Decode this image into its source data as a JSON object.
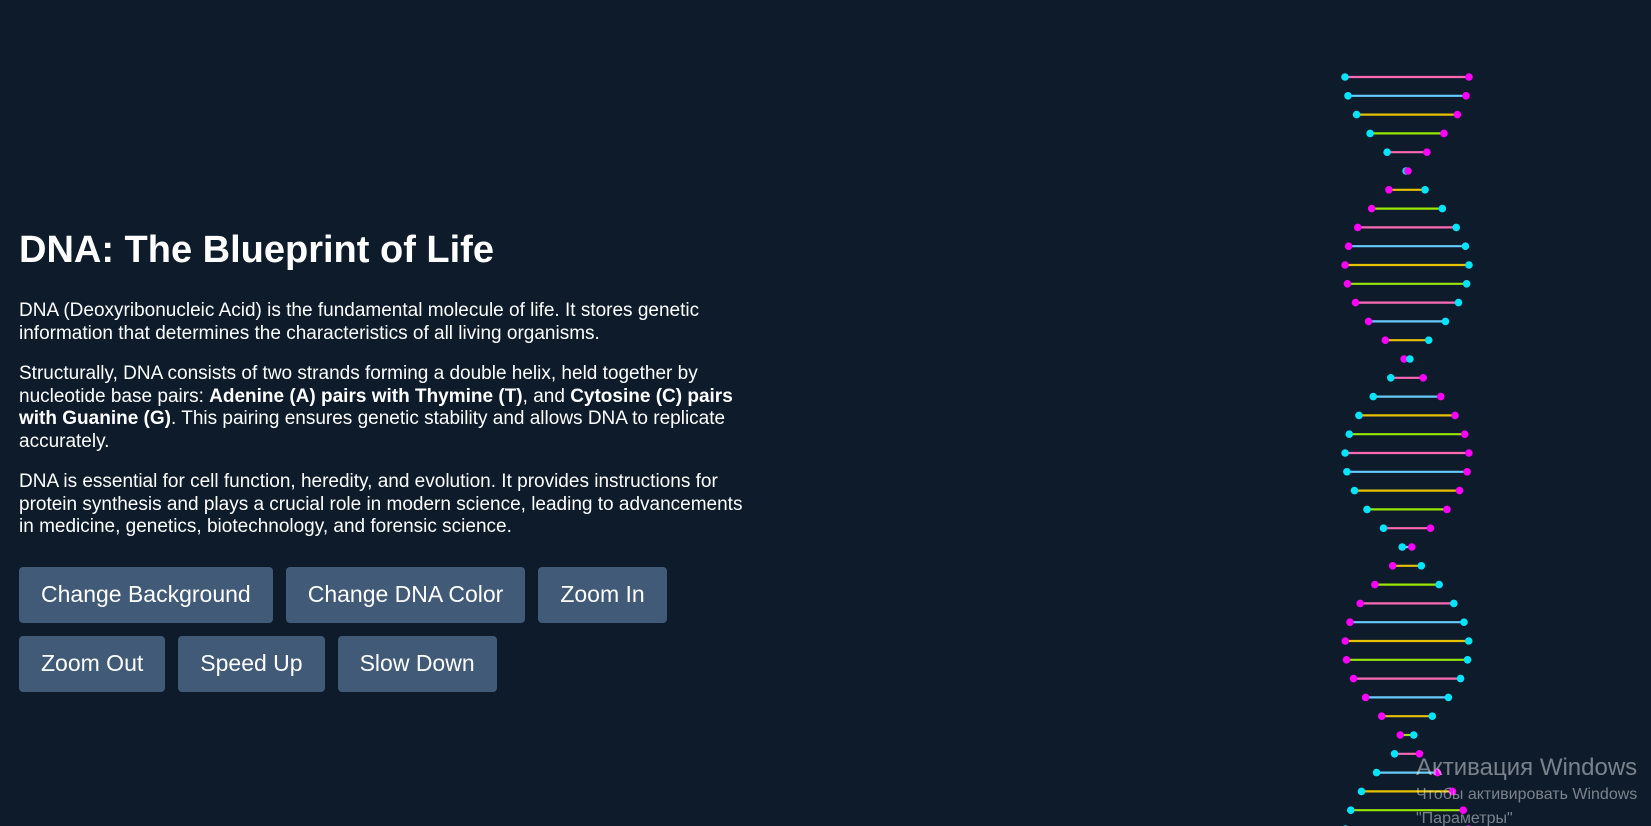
{
  "header": {
    "title": "DNA: The Blueprint of Life"
  },
  "paragraphs": {
    "p1": "DNA (Deoxyribonucleic Acid) is the fundamental molecule of life. It stores genetic information that determines the characteristics of all living organisms.",
    "p2_part1": "Structurally, DNA consists of two strands forming a double helix, held together by nucleotide base pairs: ",
    "p2_bold1": "Adenine (A) pairs with Thymine (T)",
    "p2_part2": ", and ",
    "p2_bold2": "Cytosine (C) pairs with Guanine (G)",
    "p2_part3": ". This pairing ensures genetic stability and allows DNA to replicate accurately.",
    "p3": "DNA is essential for cell function, heredity, and evolution. It provides instructions for protein synthesis and plays a crucial role in modern science, leading to advancements in medicine, genetics, biotechnology, and forensic science."
  },
  "buttons": {
    "change_background": "Change Background",
    "change_dna_color": "Change DNA Color",
    "zoom_in": "Zoom In",
    "zoom_out": "Zoom Out",
    "speed_up": "Speed Up",
    "slow_down": "Slow Down"
  },
  "helix": {
    "pair_count": 41,
    "bond_colors": [
      "#ff69b4",
      "#66ccff",
      "#e6c200",
      "#99e600"
    ],
    "strand_colors": [
      "#00e5ff",
      "#ff00ff"
    ]
  },
  "watermark": {
    "title": "Активация Windows",
    "line1": "Чтобы активировать Windows",
    "line2": "\"Параметры\""
  },
  "colors": {
    "background": "#0d1b2a",
    "button_bg": "#415a77",
    "text": "#ffffff"
  }
}
